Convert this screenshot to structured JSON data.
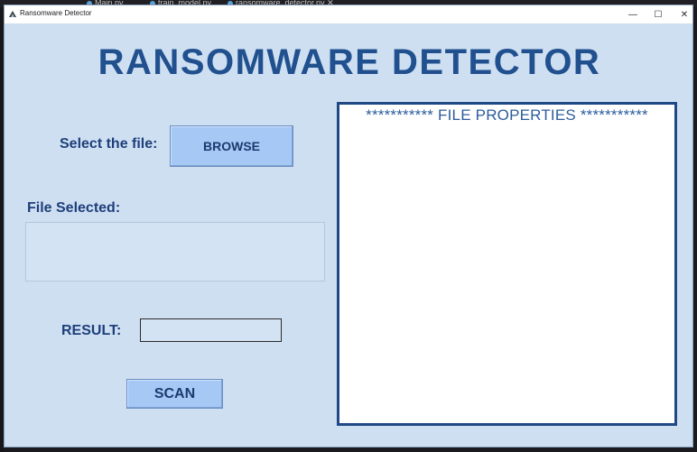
{
  "background_tabs": [
    "...",
    "Main.py",
    "train_model.py",
    "ransomware_detector.py"
  ],
  "window": {
    "title": "Ransomware Detector",
    "minimize_glyph": "—",
    "maximize_glyph": "☐",
    "close_glyph": "✕"
  },
  "app": {
    "heading": "RANSOMWARE DETECTOR",
    "select_label": "Select the file:",
    "browse_label": "BROWSE",
    "file_selected_label": "File Selected:",
    "file_selected_value": "",
    "result_label": "RESULT:",
    "result_value": "",
    "scan_label": "SCAN",
    "properties_heading": "*********** FILE PROPERTIES ***********",
    "properties_content": ""
  },
  "colors": {
    "window_bg": "#cedff2",
    "heading": "#21508f",
    "button_bg": "#a6c8f4",
    "panel_border": "#1f4885"
  }
}
